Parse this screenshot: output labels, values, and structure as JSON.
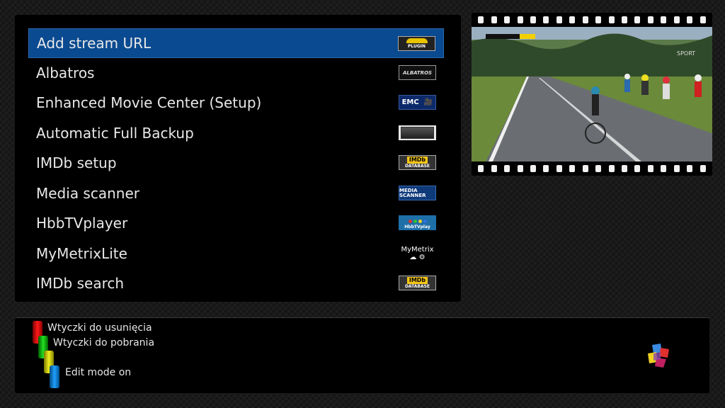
{
  "menu": {
    "items": [
      {
        "label": "Add stream URL",
        "selected": true,
        "icon": "plugin-icon",
        "icon_text": "PLUGIN"
      },
      {
        "label": "Albatros",
        "icon": "albatros-icon",
        "icon_text": "ALBATROS"
      },
      {
        "label": "Enhanced Movie Center (Setup)",
        "icon": "emc-icon",
        "icon_text": "EMC"
      },
      {
        "label": "Automatic Full Backup",
        "icon": "hdd-icon"
      },
      {
        "label": "IMDb setup",
        "icon": "imdb-icon",
        "icon_text": "IMDb",
        "icon_subtext": "DATABASE"
      },
      {
        "label": "Media scanner",
        "icon": "media-scanner-icon",
        "icon_text": "MEDIA SCANNER"
      },
      {
        "label": "HbbTVplayer",
        "icon": "hbbtv-icon",
        "icon_text": "HbbTVplay"
      },
      {
        "label": "MyMetrixLite",
        "icon": "mymetrix-icon",
        "icon_text": "MyMetrix"
      },
      {
        "label": "IMDb search",
        "icon": "imdb-icon",
        "icon_text": "IMDb",
        "icon_subtext": "DATABASE"
      }
    ]
  },
  "color_keys": {
    "red": {
      "label": "Wtyczki do usunięcia",
      "color": "#ff1a1a"
    },
    "green": {
      "label": "Wtyczki do pobrania",
      "color": "#22e022"
    },
    "yellow": {
      "label": "",
      "color": "#f0f020"
    },
    "blue": {
      "label": "Edit mode on",
      "color": "#20a0ff"
    }
  },
  "preview": {
    "icon": "tv-preview-cycling-race",
    "channel_logo": "SPORT"
  },
  "colors": {
    "selection": "#0a4a90",
    "panel": "#000000",
    "text": "#e8e8e8"
  }
}
